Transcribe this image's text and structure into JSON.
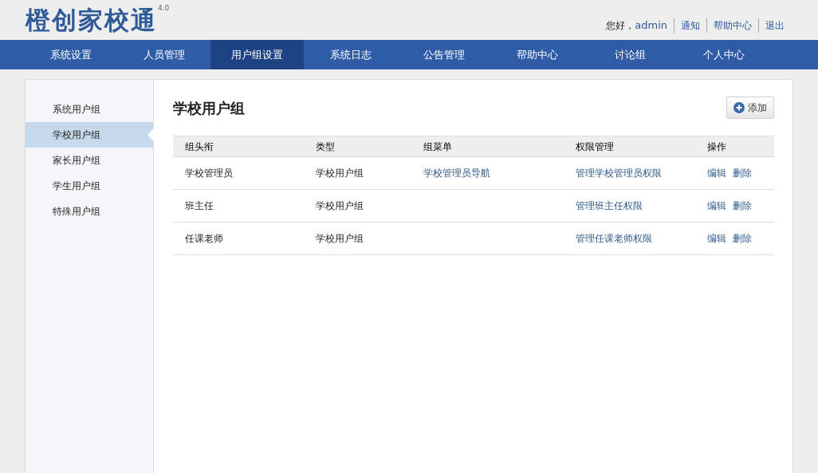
{
  "logo": {
    "name": "橙创家校通",
    "version": "4.0"
  },
  "user_links": {
    "greeting": "您好，",
    "user": "admin",
    "links": [
      "通知",
      "帮助中心",
      "退出"
    ]
  },
  "nav": [
    {
      "label": "系统设置",
      "selected": false
    },
    {
      "label": "人员管理",
      "selected": false
    },
    {
      "label": "用户组设置",
      "selected": true
    },
    {
      "label": "系统日志",
      "selected": false
    },
    {
      "label": "公告管理",
      "selected": false
    },
    {
      "label": "帮助中心",
      "selected": false
    },
    {
      "label": "讨论组",
      "selected": false
    },
    {
      "label": "个人中心",
      "selected": false
    }
  ],
  "sidebar": {
    "items": [
      {
        "label": "系统用户组",
        "selected": false
      },
      {
        "label": "学校用户组",
        "selected": true
      },
      {
        "label": "家长用户组",
        "selected": false
      },
      {
        "label": "学生用户组",
        "selected": false
      },
      {
        "label": "特殊用户组",
        "selected": false
      }
    ]
  },
  "page_title": "学校用户组",
  "add_button": "添加",
  "table": {
    "columns": [
      "组头衔",
      "类型",
      "组菜单",
      "权限管理",
      "操作"
    ],
    "rows": [
      {
        "title": "学校管理员",
        "type": "学校用户组",
        "menu": "学校管理员导航",
        "permission": "管理学校管理员权限",
        "actions": [
          "编辑",
          "删除"
        ]
      },
      {
        "title": "班主任",
        "type": "学校用户组",
        "permission": "管理班主任权限",
        "actions": [
          "编辑",
          "删除"
        ]
      },
      {
        "title": "任课老师",
        "type": "学校用户组",
        "permission": "管理任课老师权限",
        "actions": [
          "编辑",
          "删除"
        ]
      }
    ]
  }
}
